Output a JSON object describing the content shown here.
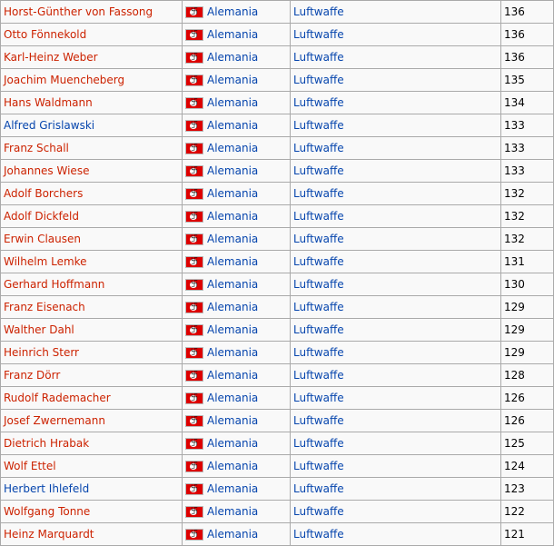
{
  "rows": [
    {
      "name": "Horst-Günther von Fassong",
      "name_color": "red",
      "country": "Alemania",
      "branch": "Luftwaffe",
      "victories": "136"
    },
    {
      "name": "Otto Fönnekold",
      "name_color": "red",
      "country": "Alemania",
      "branch": "Luftwaffe",
      "victories": "136"
    },
    {
      "name": "Karl-Heinz Weber",
      "name_color": "red",
      "country": "Alemania",
      "branch": "Luftwaffe",
      "victories": "136"
    },
    {
      "name": "Joachim Muencheberg",
      "name_color": "red",
      "country": "Alemania",
      "branch": "Luftwaffe",
      "victories": "135"
    },
    {
      "name": "Hans Waldmann",
      "name_color": "red",
      "country": "Alemania",
      "branch": "Luftwaffe",
      "victories": "134"
    },
    {
      "name": "Alfred Grislawski",
      "name_color": "blue",
      "country": "Alemania",
      "branch": "Luftwaffe",
      "victories": "133"
    },
    {
      "name": "Franz Schall",
      "name_color": "red",
      "country": "Alemania",
      "branch": "Luftwaffe",
      "victories": "133"
    },
    {
      "name": "Johannes Wiese",
      "name_color": "red",
      "country": "Alemania",
      "branch": "Luftwaffe",
      "victories": "133"
    },
    {
      "name": "Adolf Borchers",
      "name_color": "red",
      "country": "Alemania",
      "branch": "Luftwaffe",
      "victories": "132"
    },
    {
      "name": "Adolf Dickfeld",
      "name_color": "red",
      "country": "Alemania",
      "branch": "Luftwaffe",
      "victories": "132"
    },
    {
      "name": "Erwin Clausen",
      "name_color": "red",
      "country": "Alemania",
      "branch": "Luftwaffe",
      "victories": "132"
    },
    {
      "name": "Wilhelm Lemke",
      "name_color": "red",
      "country": "Alemania",
      "branch": "Luftwaffe",
      "victories": "131"
    },
    {
      "name": "Gerhard Hoffmann",
      "name_color": "red",
      "country": "Alemania",
      "branch": "Luftwaffe",
      "victories": "130"
    },
    {
      "name": "Franz Eisenach",
      "name_color": "red",
      "country": "Alemania",
      "branch": "Luftwaffe",
      "victories": "129"
    },
    {
      "name": "Walther Dahl",
      "name_color": "red",
      "country": "Alemania",
      "branch": "Luftwaffe",
      "victories": "129"
    },
    {
      "name": "Heinrich Sterr",
      "name_color": "red",
      "country": "Alemania",
      "branch": "Luftwaffe",
      "victories": "129"
    },
    {
      "name": "Franz Dörr",
      "name_color": "red",
      "country": "Alemania",
      "branch": "Luftwaffe",
      "victories": "128"
    },
    {
      "name": "Rudolf Rademacher",
      "name_color": "red",
      "country": "Alemania",
      "branch": "Luftwaffe",
      "victories": "126"
    },
    {
      "name": "Josef Zwernemann",
      "name_color": "red",
      "country": "Alemania",
      "branch": "Luftwaffe",
      "victories": "126"
    },
    {
      "name": "Dietrich Hrabak",
      "name_color": "red",
      "country": "Alemania",
      "branch": "Luftwaffe",
      "victories": "125"
    },
    {
      "name": "Wolf Ettel",
      "name_color": "red",
      "country": "Alemania",
      "branch": "Luftwaffe",
      "victories": "124"
    },
    {
      "name": "Herbert Ihlefeld",
      "name_color": "blue",
      "country": "Alemania",
      "branch": "Luftwaffe",
      "victories": "123"
    },
    {
      "name": "Wolfgang Tonne",
      "name_color": "red",
      "country": "Alemania",
      "branch": "Luftwaffe",
      "victories": "122"
    },
    {
      "name": "Heinz Marquardt",
      "name_color": "red",
      "country": "Alemania",
      "branch": "Luftwaffe",
      "victories": "121"
    }
  ],
  "colors": {
    "link_red": "#cc2200",
    "link_blue": "#0645ad",
    "border": "#aaaaaa"
  },
  "icons": {
    "country_flag": "german-war-flag-icon"
  }
}
